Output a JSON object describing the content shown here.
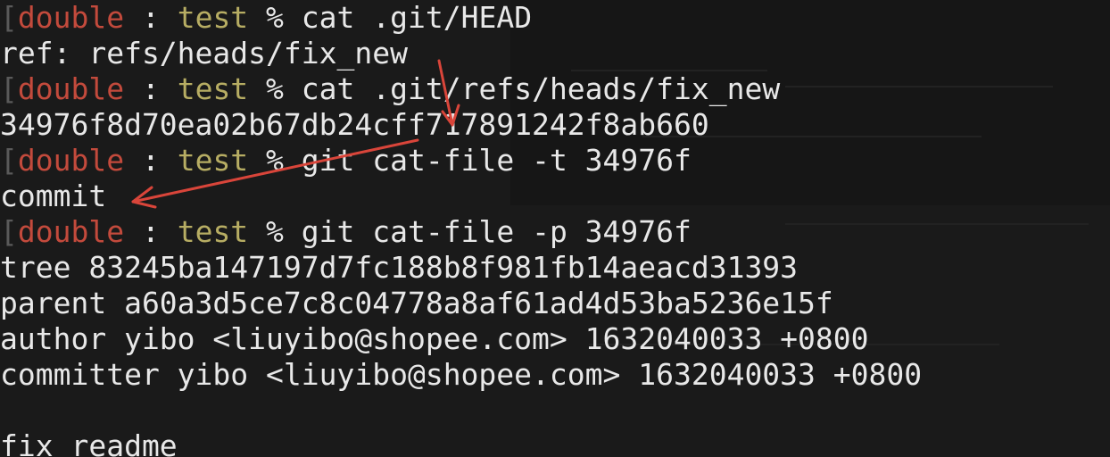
{
  "prompt": {
    "bracket": "[",
    "user": "double",
    "sep": " : ",
    "dir": "test",
    "symbol": " % "
  },
  "commands": [
    "cat .git/HEAD",
    "cat .git/refs/heads/fix_new",
    "git cat-file -t 34976f",
    "git cat-file -p 34976f"
  ],
  "outputs": {
    "head": "ref: refs/heads/fix_new",
    "hash": "34976f8d70ea02b67db24cff717891242f8ab660",
    "type": "commit",
    "tree": "tree 83245ba147197d7fc188b8f981fb14aeacd31393",
    "parent": "parent a60a3d5ce7c8c04778a8af61ad4d53ba5236e15f",
    "author": "author yibo <liuyibo@shopee.com> 1632040033 +0800",
    "committer": "committer yibo <liuyibo@shopee.com> 1632040033 +0800",
    "blank": "",
    "message": "fix readme"
  },
  "colors": {
    "background": "#1a1a1a",
    "user": "#c34a3c",
    "dir": "#b7ad63",
    "text": "#e8e8e8",
    "arrow": "#d9453a"
  }
}
